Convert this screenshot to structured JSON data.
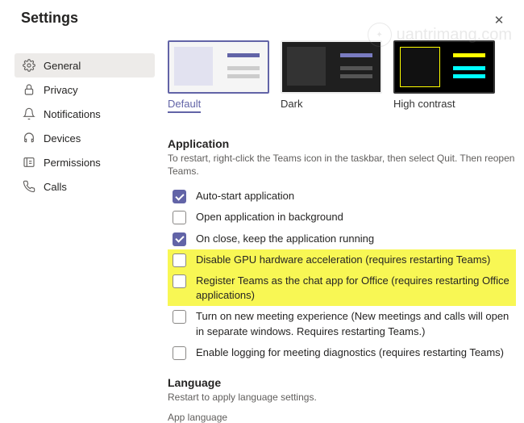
{
  "header": {
    "title": "Settings",
    "close": "✕"
  },
  "sidebar": {
    "items": [
      {
        "label": "General"
      },
      {
        "label": "Privacy"
      },
      {
        "label": "Notifications"
      },
      {
        "label": "Devices"
      },
      {
        "label": "Permissions"
      },
      {
        "label": "Calls"
      }
    ]
  },
  "themes": {
    "default": "Default",
    "dark": "Dark",
    "high_contrast": "High contrast"
  },
  "application": {
    "title": "Application",
    "subtitle": "To restart, right-click the Teams icon in the taskbar, then select Quit. Then reopen Teams.",
    "options": {
      "auto_start": "Auto-start application",
      "open_bg": "Open application in background",
      "on_close": "On close, keep the application running",
      "gpu": "Disable GPU hardware acceleration (requires restarting Teams)",
      "register": "Register Teams as the chat app for Office (requires restarting Office applications)",
      "new_meeting": "Turn on new meeting experience (New meetings and calls will open in separate windows. Requires restarting Teams.)",
      "logging": "Enable logging for meeting diagnostics (requires restarting Teams)"
    }
  },
  "language": {
    "title": "Language",
    "subtitle": "Restart to apply language settings.",
    "app_language_label": "App language"
  },
  "watermark": {
    "text": "uantrimang.com"
  }
}
